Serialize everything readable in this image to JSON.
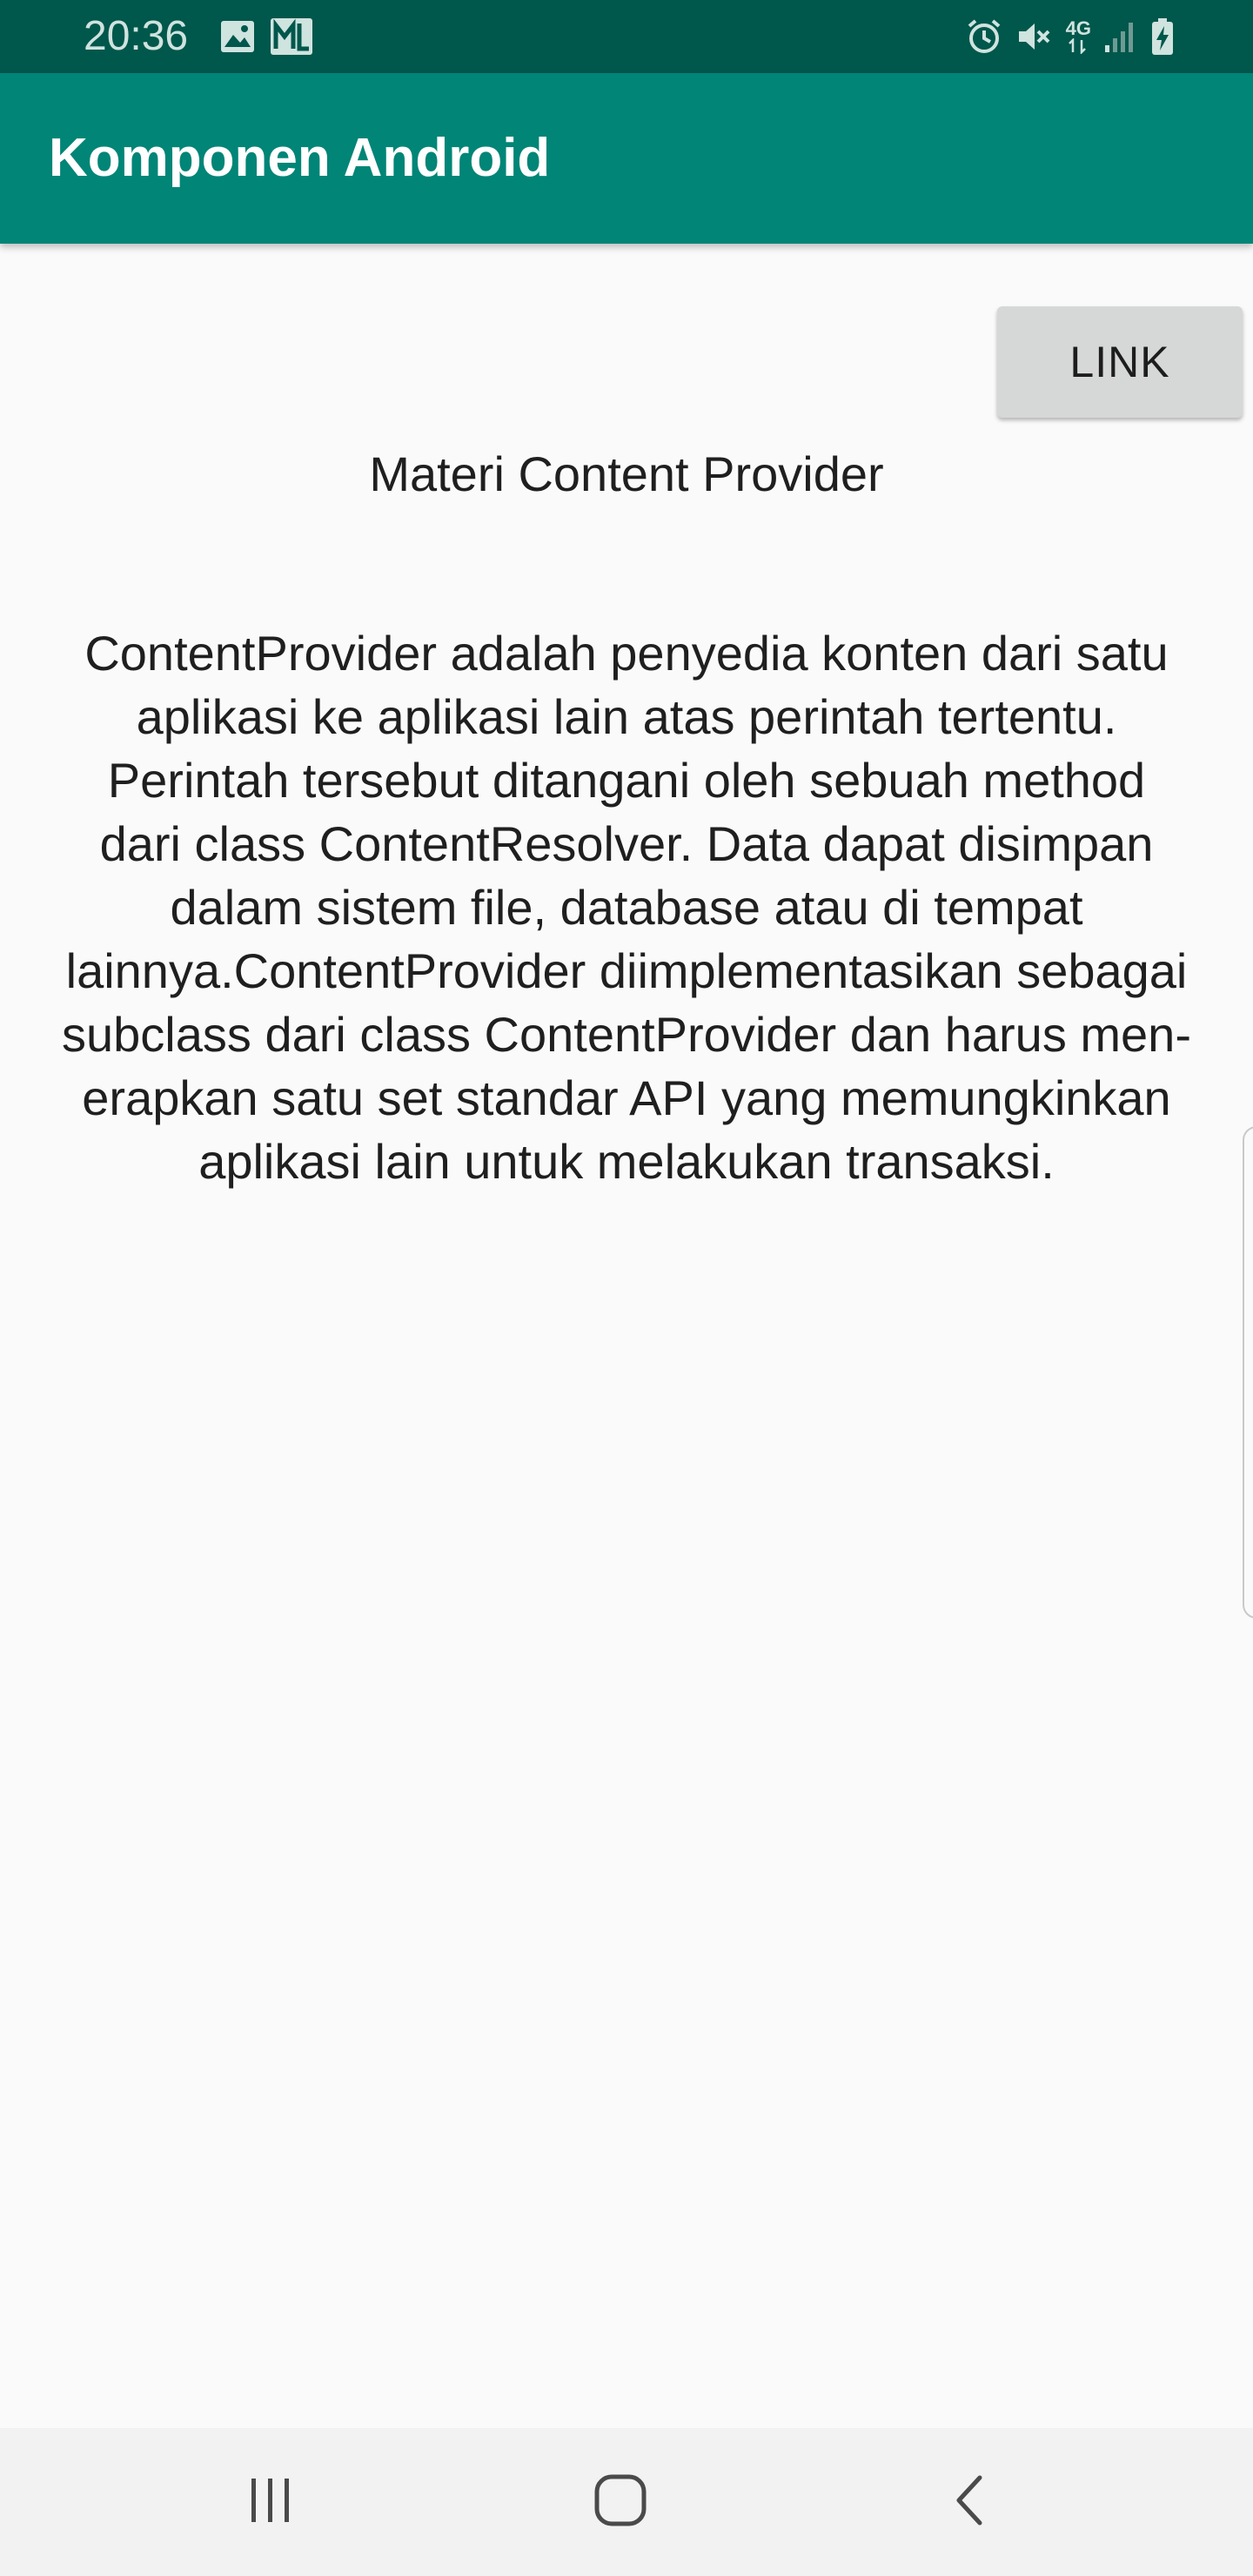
{
  "status_bar": {
    "time": "20:36",
    "network_label": "4G",
    "left_icons": [
      "image-icon",
      "gmail-icon"
    ],
    "right_icons": [
      "alarm-icon",
      "mute-icon",
      "network-4g-icon",
      "signal-icon",
      "battery-charging-icon"
    ]
  },
  "app_bar": {
    "title": "Komponen Android",
    "color": "#008577"
  },
  "content": {
    "link_button_label": "LINK",
    "materi_title": "Materi Content Provider",
    "description_lines": [
      "ContentProvider adalah penyedia konten dari satu",
      "aplikasi ke aplikasi lain atas perintah tertentu.",
      "Perintah tersebut ditangani oleh sebuah method",
      "dari class ContentResolver. Data dapat disimpan",
      "dalam sistem file, database atau di tempat",
      "lainnya.ContentProvider diimplementasikan sebagai",
      "subclass dari class ContentProvider dan harus men-",
      "erapkan satu set standar API yang memungkinkan",
      "aplikasi lain untuk melakukan transaksi."
    ]
  },
  "nav_bar": {
    "buttons": [
      "recents-icon",
      "home-icon",
      "back-icon"
    ]
  },
  "colors": {
    "status_bar": "#00574b",
    "app_bar": "#008577",
    "background": "#fafafa",
    "button": "#d6d7d7"
  }
}
